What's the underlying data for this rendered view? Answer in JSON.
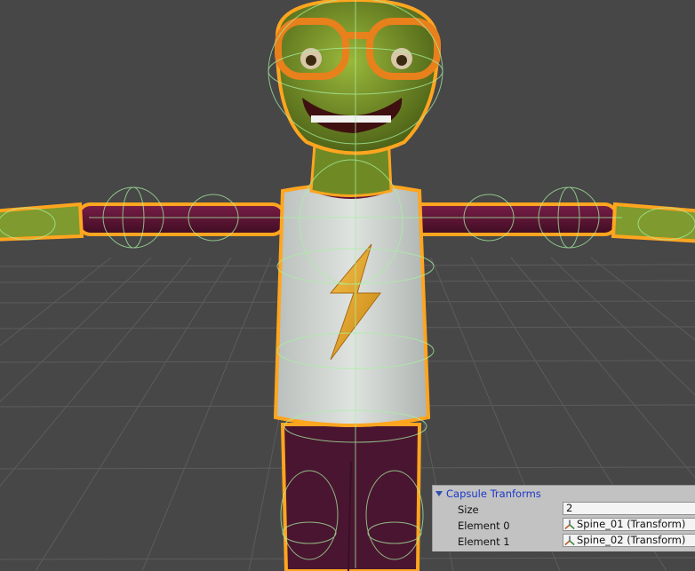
{
  "scene": {
    "background": "#474747",
    "grid_color": "#5c5c5c",
    "character": {
      "skin": "#7f9a2e",
      "skin_dark": "#4f6418",
      "shirt": "#d6dbd8",
      "sleeves": "#5e1434",
      "pants": "#4a1530",
      "glasses": "#e8801c",
      "bolt": "#e0a020",
      "selection_outline": "#ffa51f",
      "collider_gizmo": "#a8f0a0"
    }
  },
  "inspector": {
    "title": "Capsule Tranforms",
    "rows": [
      {
        "label": "Size",
        "value": "2",
        "kind": "number"
      },
      {
        "label": "Element 0",
        "value": "Spine_01 (Transform)",
        "kind": "object",
        "icon": "transform-icon"
      },
      {
        "label": "Element 1",
        "value": "Spine_02 (Transform)",
        "kind": "object",
        "icon": "transform-icon"
      }
    ]
  }
}
